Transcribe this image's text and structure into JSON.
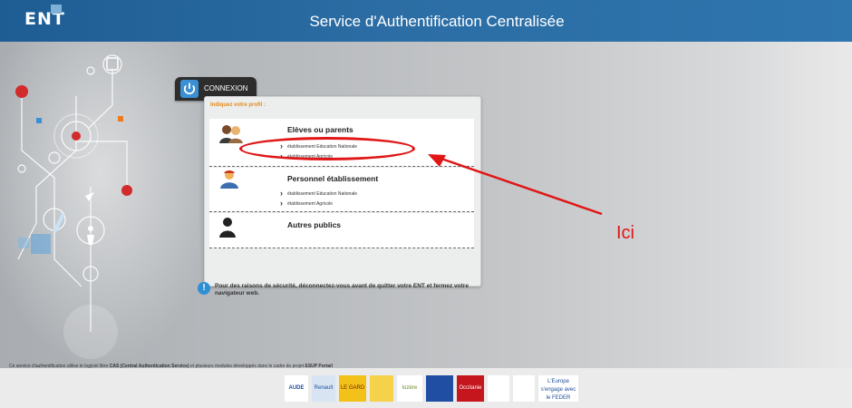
{
  "header": {
    "logo_text": "ENT",
    "title": "Service d'Authentification Centralisée"
  },
  "login": {
    "tab_label": "CONNEXION",
    "profile_prompt": "Indiquez votre profil :",
    "profiles": [
      {
        "title": "Elèves ou parents",
        "links": [
          "établissement Education Nationale",
          "établissement Agricole"
        ]
      },
      {
        "title": "Personnel établissement",
        "links": [
          "établissement Education Nationale",
          "établissement Agricole"
        ]
      },
      {
        "title": "Autres publics",
        "links": []
      }
    ]
  },
  "notice": {
    "text": "Pour des raisons de sécurité, déconnectez-vous avant de quitter votre ENT et fermez votre navigateur web."
  },
  "footer": {
    "text_prefix": "Ce service d'authentification utilise le logiciel libre ",
    "cas_label": "CAS (Central Authentication Service)",
    "text_middle": " et plusieurs modules développés dans le cadre du projet ",
    "esup_label": "ESUP Portail",
    "partner_logos": [
      "AUDE",
      "Renault",
      "LE GARD",
      "",
      "lozère",
      "",
      "Occitanie",
      "",
      "",
      "L'Europe s'engage avec le FEDER"
    ]
  },
  "annotation": {
    "label": "Ici",
    "color": "#e01616"
  },
  "colors": {
    "header": "#2b6da4",
    "accent_orange": "#e38b1c",
    "power_blue": "#3b8fd2"
  }
}
